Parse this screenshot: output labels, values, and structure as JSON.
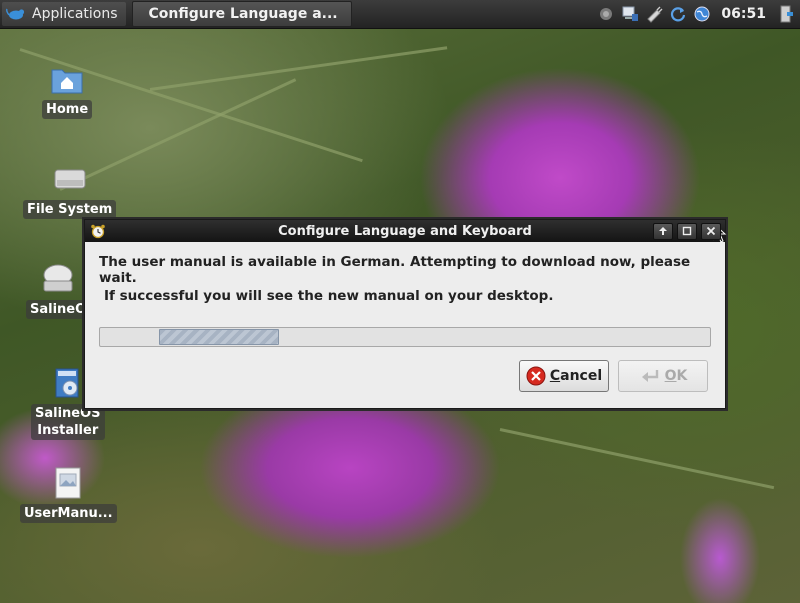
{
  "panel": {
    "applications_label": "Applications",
    "task_title": "Configure Language a...",
    "clock": "06:51"
  },
  "desktop": {
    "icons": [
      {
        "label": "Home",
        "icon": "home-folder-icon"
      },
      {
        "label": "File System",
        "icon": "drive-icon"
      },
      {
        "label": "SalineO",
        "icon": "disc-drive-icon"
      },
      {
        "label": "SalineOS\nInstaller",
        "icon": "installer-icon"
      },
      {
        "label": "UserManu...",
        "icon": "image-file-icon"
      }
    ]
  },
  "dialog": {
    "title": "Configure Language and Keyboard",
    "message_line1": "The user manual is available in German. Attempting to download now, please wait.",
    "message_line2": "If successful you will see the new manual on your desktop.",
    "progress_state": "indeterminate",
    "cancel_label": "Cancel",
    "cancel_mnemonic": "C",
    "cancel_rest": "ancel",
    "ok_label": "OK",
    "ok_mnemonic": "O",
    "ok_rest": "K",
    "ok_enabled": false
  },
  "colors": {
    "panel_bg": "#2e2e2e",
    "titlebar_bg": "#1e1e1e",
    "dialog_bg": "#ededed",
    "cancel_icon_red": "#d62a20",
    "progress_fill": "#a7b3c3"
  }
}
